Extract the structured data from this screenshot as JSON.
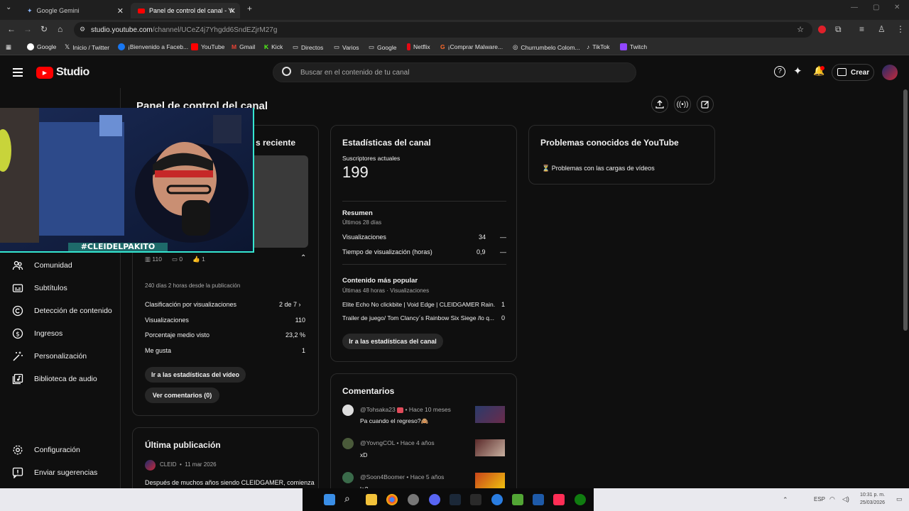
{
  "browser": {
    "tabs": [
      {
        "title": "Google Gemini",
        "active": false
      },
      {
        "title": "Panel de control del canal - You",
        "active": true
      }
    ],
    "url_host": "studio.youtube.com",
    "url_path": "/channel/UCeZ4j7Yhgdd6SndEZjrM27g",
    "bookmarks": [
      "Google",
      "Inicio / Twitter",
      "¡Bienvenido a Faceb...",
      "YouTube",
      "Gmail",
      "Kick",
      "Directos",
      "Varios",
      "Google",
      "Netflix",
      "¡Comprar Malware...",
      "Churrumbelo Colom...",
      "TikTok",
      "Twitch"
    ]
  },
  "header": {
    "brand": "Studio",
    "search_placeholder": "Buscar en el contenido de tu canal",
    "create_label": "Crear"
  },
  "page_title": "Panel de control del canal",
  "sidebar": {
    "items": [
      {
        "label": "Comunidad",
        "icon": "community-icon"
      },
      {
        "label": "Subtítulos",
        "icon": "subtitles-icon"
      },
      {
        "label": "Detección de contenido",
        "icon": "copyright-icon"
      },
      {
        "label": "Ingresos",
        "icon": "dollar-icon"
      },
      {
        "label": "Personalización",
        "icon": "magic-wand-icon"
      },
      {
        "label": "Biblioteca de audio",
        "icon": "audio-library-icon"
      }
    ],
    "footer": [
      {
        "label": "Configuración",
        "icon": "gear-icon"
      },
      {
        "label": "Enviar sugerencias",
        "icon": "feedback-icon"
      }
    ]
  },
  "latest_video": {
    "title_partial": "s reciente",
    "stats": {
      "views": "110",
      "comments": "0",
      "likes": "1"
    },
    "age": "240 días 2 horas desde la publicación",
    "rows": [
      {
        "label": "Clasificación por visualizaciones",
        "value": "2 de 7"
      },
      {
        "label": "Visualizaciones",
        "value": "110"
      },
      {
        "label": "Porcentaje medio visto",
        "value": "23,2 %"
      },
      {
        "label": "Me gusta",
        "value": "1"
      }
    ],
    "btn_stats": "Ir a las estadísticas del vídeo",
    "btn_comments": "Ver comentarios (0)"
  },
  "last_post": {
    "title": "Última publicación",
    "author": "CLEID",
    "date": "11 mar 2026",
    "text": "Después de muchos años siendo CLEIDGAMER, comienza"
  },
  "channel_stats": {
    "title": "Estadísticas del canal",
    "subs_label": "Suscriptores actuales",
    "subs_value": "199",
    "summary_title": "Resumen",
    "summary_period": "Últimos 28 días",
    "summary_rows": [
      {
        "label": "Visualizaciones",
        "value": "34",
        "trend": "—"
      },
      {
        "label": "Tiempo de visualización (horas)",
        "value": "0,9",
        "trend": "—"
      }
    ],
    "popular_title": "Contenido más popular",
    "popular_period": "Últimas 48 horas · Visualizaciones",
    "popular_rows": [
      {
        "label": "Elite Echo No clickbite | Void Edge | CLEIDGAMER Rain...",
        "value": "1"
      },
      {
        "label": "Trailer de juego/ Tom Clancy´s Rainbow Six Siege /lo q...",
        "value": "0"
      }
    ],
    "btn": "Ir a las estadísticas del canal"
  },
  "comments": {
    "title": "Comentarios",
    "items": [
      {
        "user": "@Tohsaka23",
        "time": "• Hace 10 meses",
        "text": "Pa cuando el regreso?🙈"
      },
      {
        "user": "@YovngCOL",
        "time": "• Hace 4 años",
        "text": "xD"
      },
      {
        "user": "@Soon4Boomer",
        "time": "• Hace 5 años",
        "text": "la?"
      }
    ]
  },
  "issues": {
    "title": "Problemas conocidos de YouTube",
    "item": "Problemas con las cargas de vídeos"
  },
  "webcam": {
    "tag": "#CLEIDELPAKITO"
  },
  "taskbar": {
    "lang": "ESP",
    "time": "10:31 p. m.",
    "date": "25/03/2026"
  },
  "colors": {
    "yt_red": "#ff0000",
    "accent_cyan": "#35e6d0",
    "bg": "#0f0f0f"
  }
}
